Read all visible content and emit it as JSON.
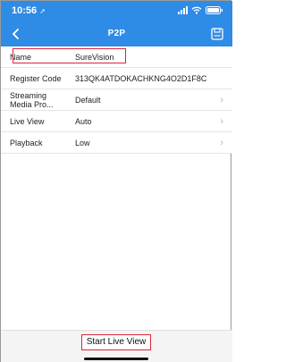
{
  "status_bar": {
    "time": "10:56",
    "location_icon": "location-arrow-icon",
    "signal_icon": "signal-bars-icon",
    "wifi_icon": "wifi-icon",
    "battery_icon": "battery-icon"
  },
  "nav": {
    "title": "P2P",
    "back_icon": "chevron-left-icon",
    "save_icon": "save-icon"
  },
  "rows": [
    {
      "label": "Name",
      "value": "SureVision",
      "chevron": false
    },
    {
      "label": "Register Code",
      "value": "313QK4ATDOKACHKNG4O2D1F8C",
      "chevron": false
    },
    {
      "label": "Streaming Media Pro...",
      "value": "Default",
      "chevron": true
    },
    {
      "label": "Live View",
      "value": "Auto",
      "chevron": true
    },
    {
      "label": "Playback",
      "value": "Low",
      "chevron": true
    }
  ],
  "footer": {
    "start_label": "Start Live View"
  },
  "colors": {
    "accent": "#2e8be6",
    "highlight": "#d7263d"
  }
}
